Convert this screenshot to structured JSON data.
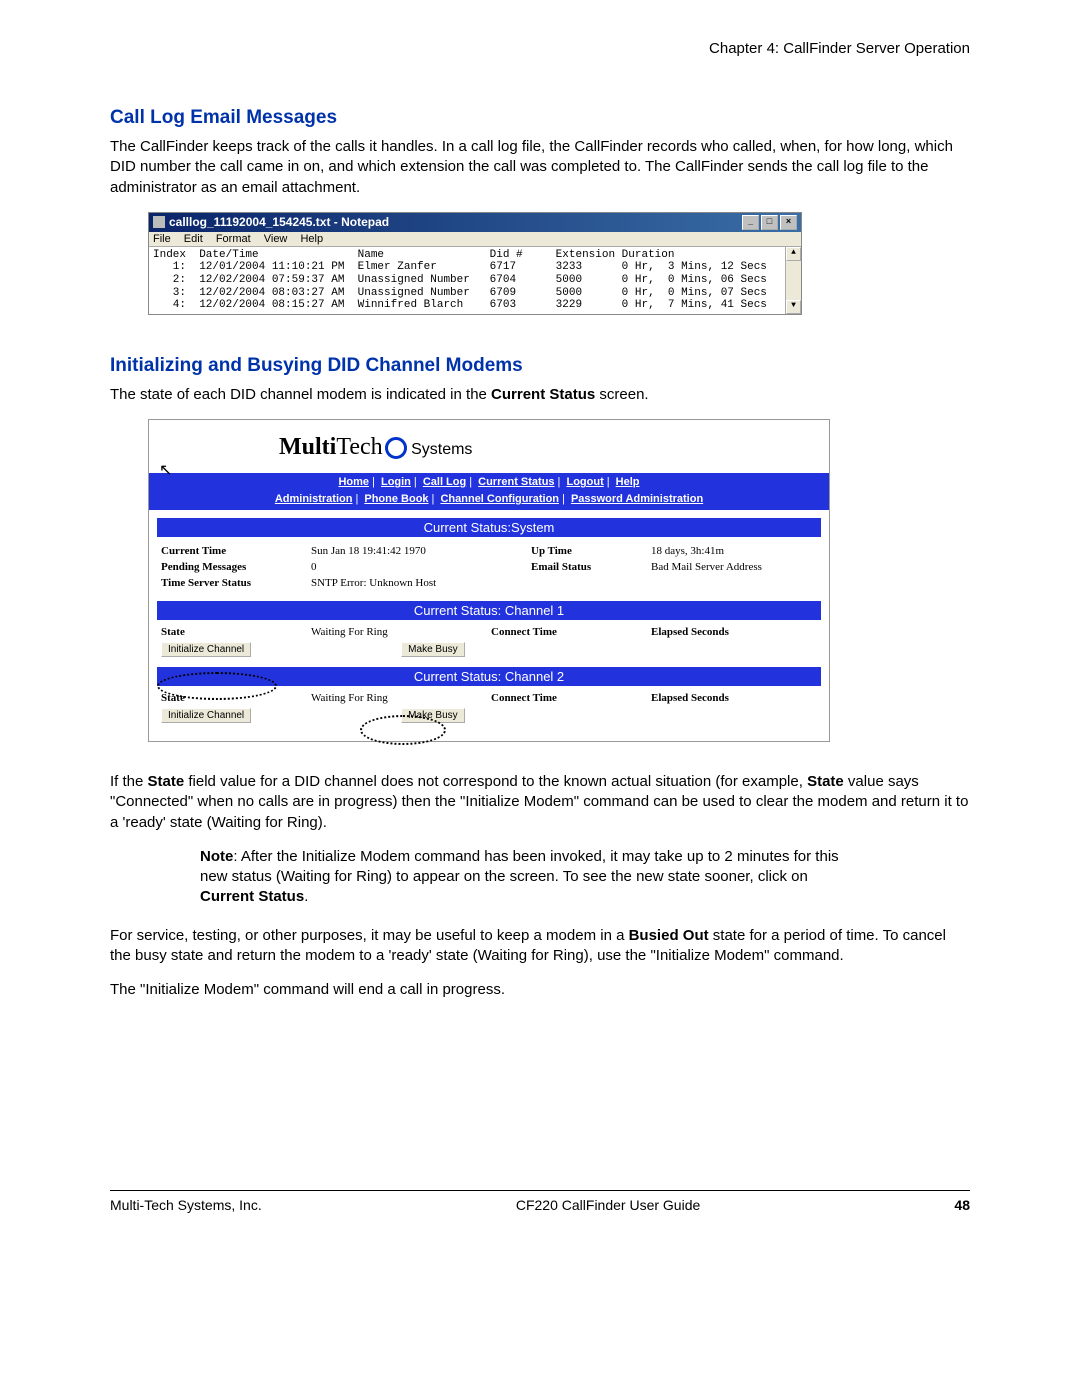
{
  "chapter_header": "Chapter 4:  CallFinder Server Operation",
  "section1_heading": "Call Log Email Messages",
  "section1_body": "The CallFinder keeps track of the calls it handles. In a call log file, the CallFinder records who called, when, for how long, which DID number the call came in on, and which extension the call was completed to.  The CallFinder sends the call log file to the administrator as an email attachment.",
  "notepad": {
    "title": "calllog_11192004_154245.txt - Notepad",
    "menu": [
      "File",
      "Edit",
      "Format",
      "View",
      "Help"
    ],
    "header_row": "Index  Date/Time               Name                Did #     Extension Duration",
    "rows": [
      "   1:  12/01/2004 11:10:21 PM  Elmer Zanfer        6717      3233      0 Hr,  3 Mins, 12 Secs",
      "   2:  12/02/2004 07:59:37 AM  Unassigned Number   6704      5000      0 Hr,  0 Mins, 06 Secs",
      "   3:  12/02/2004 08:03:27 AM  Unassigned Number   6709      5000      0 Hr,  0 Mins, 07 Secs",
      "   4:  12/02/2004 08:15:27 AM  Winnifred Blarch    6703      3229      0 Hr,  7 Mins, 41 Secs"
    ]
  },
  "section2_heading": "Initializing and Busying DID Channel Modems",
  "section2_body_pre": "The state of each DID channel modem is indicated in the ",
  "section2_body_bold": "Current Status",
  "section2_body_post": " screen.",
  "status": {
    "logo_bold": "Multi",
    "logo_rest": "Tech",
    "logo_sub": "Systems",
    "nav": [
      "Home",
      "Login",
      "Call Log",
      "Current Status",
      "Logout",
      "Help"
    ],
    "subnav": [
      "Administration",
      "Phone Book",
      "Channel Configuration",
      "Password Administration"
    ],
    "sysbar": "Current Status:System",
    "sys": {
      "current_time_lbl": "Current Time",
      "current_time_val": "Sun Jan 18 19:41:42 1970",
      "up_time_lbl": "Up Time",
      "up_time_val": "18 days, 3h:41m",
      "pending_lbl": "Pending Messages",
      "pending_val": "0",
      "email_lbl": "Email Status",
      "email_val": "Bad Mail Server Address",
      "tss_lbl": "Time Server Status",
      "tss_val": "SNTP Error: Unknown Host"
    },
    "ch1bar": "Current Status: Channel 1",
    "ch2bar": "Current Status: Channel 2",
    "ch": {
      "state_lbl": "State",
      "state_val": "Waiting For Ring",
      "ct_lbl": "Connect Time",
      "es_lbl": "Elapsed Seconds",
      "init_btn": "Initialize Channel",
      "busy_btn": "Make Busy"
    }
  },
  "para_if_1": "If the ",
  "para_if_b1": "State",
  "para_if_2": " field value for a DID channel does not correspond to the known actual situation (for example, ",
  "para_if_b2": "State",
  "para_if_3": " value says \"Connected\" when no calls are in progress) then the \"Initialize Modem\" command can be used to clear the modem and return it to a 'ready' state (Waiting for Ring).",
  "note_b": "Note",
  "note_body_pre": ":  After the Initialize Modem command has been invoked, it may take up to 2 minutes for this new status (Waiting for Ring) to appear on the screen.  To see the new state sooner, click on ",
  "note_body_bold": "Current Status",
  "note_body_post": ".",
  "para_svc_1": "For service, testing, or other purposes, it may be useful to keep a modem in a ",
  "para_svc_b": "Busied Out",
  "para_svc_2": " state for a period of time.  To cancel the busy state and return the modem to a 'ready' state (Waiting for Ring), use the \"Initialize Modem\" command.",
  "para_end": "The \"Initialize Modem\" command will end a call in progress.",
  "footer": {
    "left": "Multi-Tech Systems, Inc.",
    "center": "CF220 CallFinder User Guide",
    "page": "48"
  }
}
